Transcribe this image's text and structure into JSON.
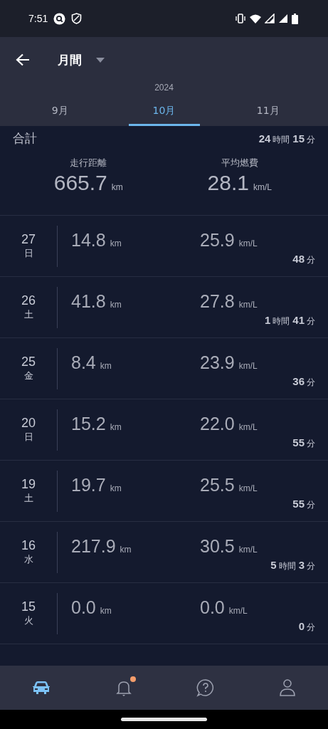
{
  "status_bar": {
    "time": "7:51"
  },
  "header": {
    "title": "月間",
    "year": "2024"
  },
  "tabs": [
    {
      "label": "9月",
      "selected": false
    },
    {
      "label": "10月",
      "selected": true
    },
    {
      "label": "11月",
      "selected": false
    }
  ],
  "summary": {
    "label": "合計",
    "total_time": [
      {
        "num": "24",
        "unit": "時間"
      },
      {
        "num": "15",
        "unit": "分"
      }
    ],
    "distance": {
      "label": "走行距離",
      "value": "665.7",
      "unit": "km"
    },
    "fuel": {
      "label": "平均燃費",
      "value": "28.1",
      "unit": "km/L"
    }
  },
  "days": [
    {
      "day": "27",
      "weekday": "日",
      "distance": "14.8",
      "distance_unit": "km",
      "fuel": "25.9",
      "fuel_unit": "km/L",
      "time": [
        {
          "num": "48",
          "unit": "分"
        }
      ]
    },
    {
      "day": "26",
      "weekday": "土",
      "distance": "41.8",
      "distance_unit": "km",
      "fuel": "27.8",
      "fuel_unit": "km/L",
      "time": [
        {
          "num": "1",
          "unit": "時間"
        },
        {
          "num": "41",
          "unit": "分"
        }
      ]
    },
    {
      "day": "25",
      "weekday": "金",
      "distance": "8.4",
      "distance_unit": "km",
      "fuel": "23.9",
      "fuel_unit": "km/L",
      "time": [
        {
          "num": "36",
          "unit": "分"
        }
      ]
    },
    {
      "day": "20",
      "weekday": "日",
      "distance": "15.2",
      "distance_unit": "km",
      "fuel": "22.0",
      "fuel_unit": "km/L",
      "time": [
        {
          "num": "55",
          "unit": "分"
        }
      ]
    },
    {
      "day": "19",
      "weekday": "土",
      "distance": "19.7",
      "distance_unit": "km",
      "fuel": "25.5",
      "fuel_unit": "km/L",
      "time": [
        {
          "num": "55",
          "unit": "分"
        }
      ]
    },
    {
      "day": "16",
      "weekday": "水",
      "distance": "217.9",
      "distance_unit": "km",
      "fuel": "30.5",
      "fuel_unit": "km/L",
      "time": [
        {
          "num": "5",
          "unit": "時間"
        },
        {
          "num": "3",
          "unit": "分"
        }
      ]
    },
    {
      "day": "15",
      "weekday": "火",
      "distance": "0.0",
      "distance_unit": "km",
      "fuel": "0.0",
      "fuel_unit": "km/L",
      "time": [
        {
          "num": "0",
          "unit": "分"
        }
      ]
    }
  ],
  "nav": [
    {
      "kind": "car",
      "selected": true
    },
    {
      "kind": "bell",
      "selected": false,
      "badge": true
    },
    {
      "kind": "help",
      "selected": false
    },
    {
      "kind": "person",
      "selected": false
    }
  ]
}
